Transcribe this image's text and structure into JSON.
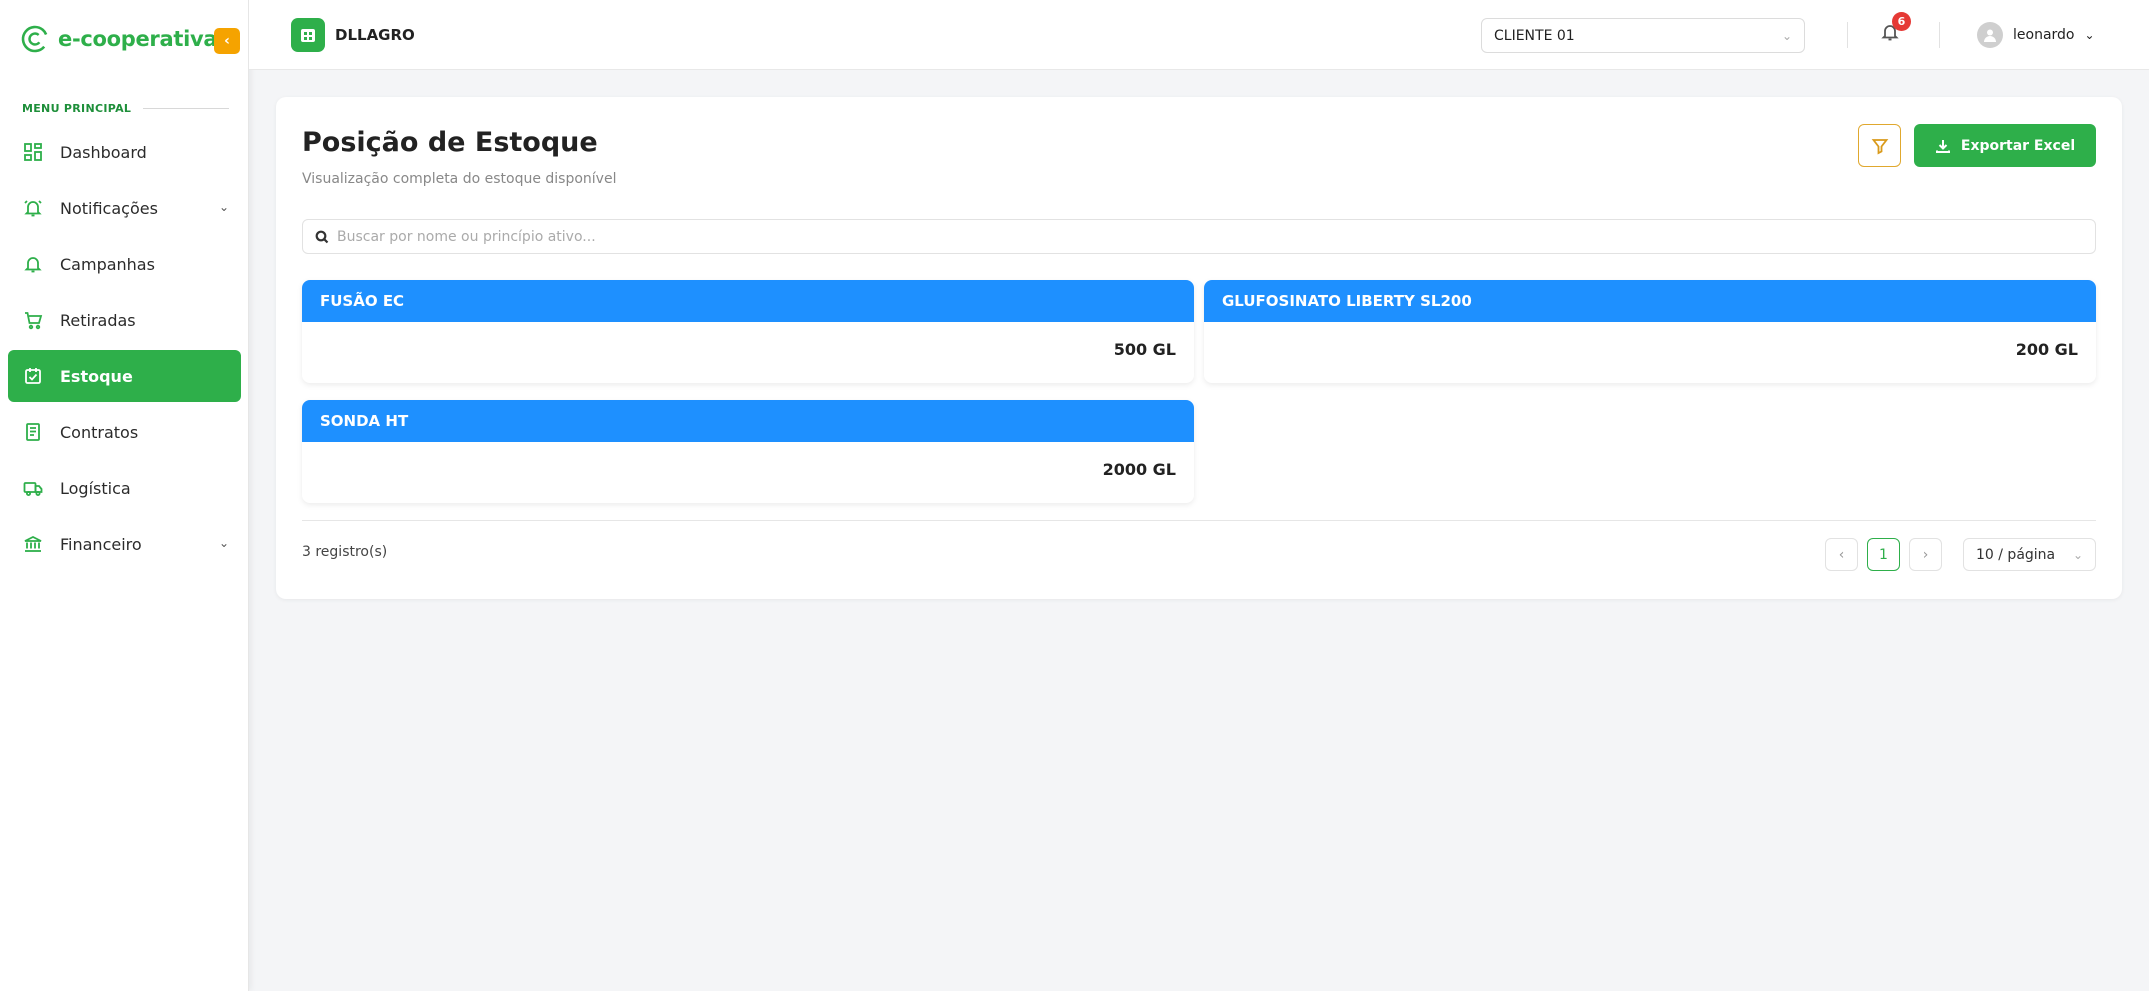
{
  "brand": {
    "name": "e-cooperativa",
    "collapse_icon": "‹"
  },
  "sidebar": {
    "heading": "MENU PRINCIPAL",
    "items": [
      {
        "label": "Dashboard",
        "icon": "dashboard-icon",
        "expandable": false
      },
      {
        "label": "Notificações",
        "icon": "alarm-bell-icon",
        "expandable": true
      },
      {
        "label": "Campanhas",
        "icon": "bell-icon",
        "expandable": false
      },
      {
        "label": "Retiradas",
        "icon": "cart-icon",
        "expandable": false
      },
      {
        "label": "Estoque",
        "icon": "inventory-icon",
        "expandable": false,
        "active": true
      },
      {
        "label": "Contratos",
        "icon": "document-icon",
        "expandable": false
      },
      {
        "label": "Logística",
        "icon": "truck-icon",
        "expandable": false
      },
      {
        "label": "Financeiro",
        "icon": "bank-icon",
        "expandable": true
      }
    ]
  },
  "header": {
    "org_name": "DLLAGRO",
    "client_select": "CLIENTE 01",
    "notification_count": "6",
    "username": "leonardo"
  },
  "page": {
    "title": "Posição de Estoque",
    "subtitle": "Visualização completa do estoque disponível",
    "export_label": "Exportar Excel",
    "search_placeholder": "Buscar por nome ou princípio ativo..."
  },
  "stock": [
    {
      "name": "FUSÃO EC",
      "quantity": "500 GL"
    },
    {
      "name": "GLUFOSINATO LIBERTY SL200",
      "quantity": "200 GL"
    },
    {
      "name": "SONDA HT",
      "quantity": "2000 GL"
    }
  ],
  "pagination": {
    "count": "3 registro(s)",
    "prev": "‹",
    "current": "1",
    "next": "›",
    "page_size": "10 / página"
  },
  "colors": {
    "primary_green": "#2eaf4a",
    "card_header_blue": "#1e90ff",
    "collapse_orange": "#f5a300",
    "badge_red": "#e53935"
  }
}
